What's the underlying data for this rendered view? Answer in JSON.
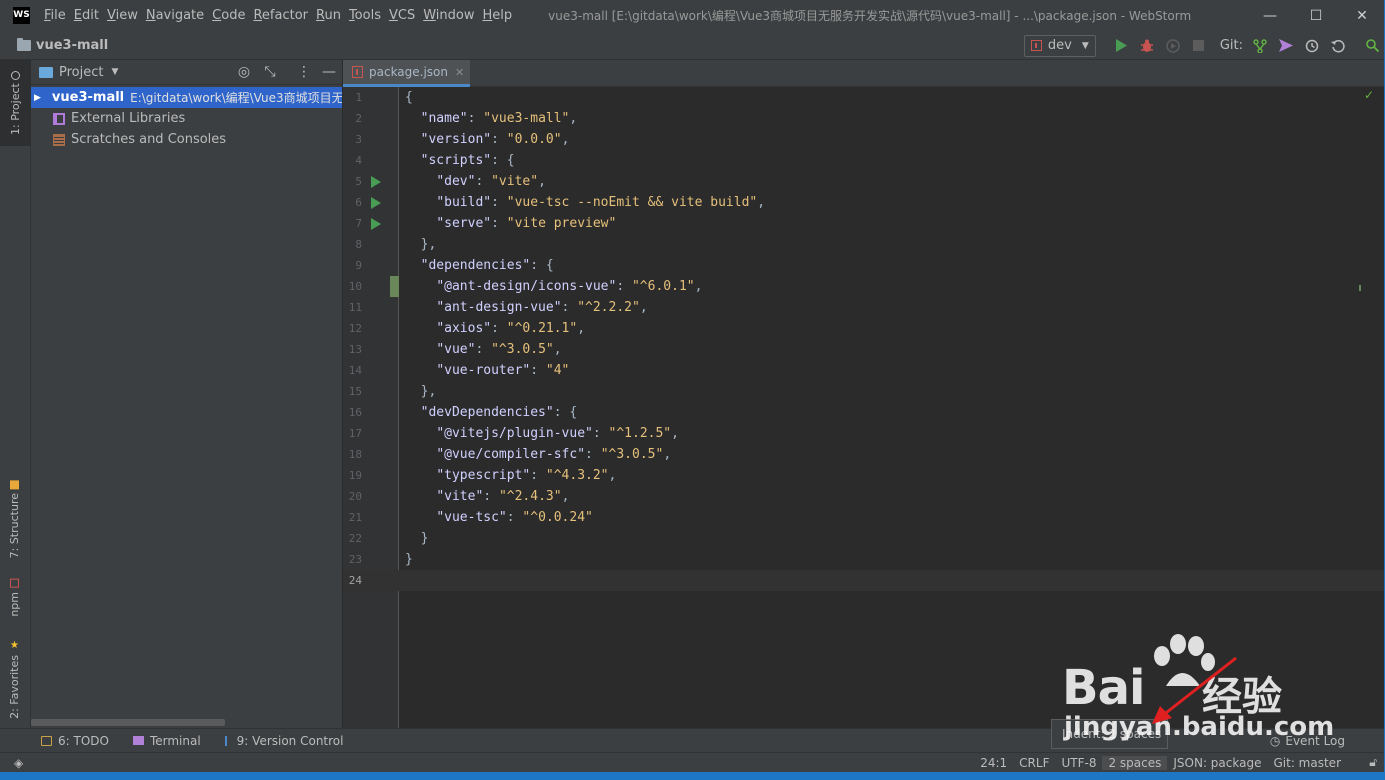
{
  "app": {
    "logo": "WS",
    "window_title": "vue3-mall [E:\\gitdata\\work\\编程\\Vue3商城项目无服务开发实战\\源代码\\vue3-mall] - ...\\package.json - WebStorm"
  },
  "menu": [
    "File",
    "Edit",
    "View",
    "Navigate",
    "Code",
    "Refactor",
    "Run",
    "Tools",
    "VCS",
    "Window",
    "Help"
  ],
  "window_controls": {
    "minimize": "—",
    "maximize": "☐",
    "close": "✕"
  },
  "navbar": {
    "project_name": "vue3-mall",
    "run_config": "dev",
    "git_label": "Git:"
  },
  "left_stripe": {
    "project": "1: Project",
    "structure": "7: Structure",
    "npm": "npm",
    "favorites": "2: Favorites"
  },
  "project_panel": {
    "title": "Project",
    "tree": [
      {
        "name": "vue3-mall",
        "path": "E:\\gitdata\\work\\编程\\Vue3商城项目无"
      },
      {
        "name": "External Libraries"
      },
      {
        "name": "Scratches and Consoles"
      }
    ]
  },
  "editor": {
    "tab": "package.json",
    "current_line": 24,
    "lines": [
      {
        "n": "1",
        "text": "{"
      },
      {
        "n": "2",
        "text": "  \"name\": \"vue3-mall\","
      },
      {
        "n": "3",
        "text": "  \"version\": \"0.0.0\","
      },
      {
        "n": "4",
        "text": "  \"scripts\": {"
      },
      {
        "n": "5",
        "text": "    \"dev\": \"vite\","
      },
      {
        "n": "6",
        "text": "    \"build\": \"vue-tsc --noEmit && vite build\","
      },
      {
        "n": "7",
        "text": "    \"serve\": \"vite preview\""
      },
      {
        "n": "8",
        "text": "  },"
      },
      {
        "n": "9",
        "text": "  \"dependencies\": {"
      },
      {
        "n": "10",
        "text": "    \"@ant-design/icons-vue\": \"^6.0.1\","
      },
      {
        "n": "11",
        "text": "    \"ant-design-vue\": \"^2.2.2\","
      },
      {
        "n": "12",
        "text": "    \"axios\": \"^0.21.1\","
      },
      {
        "n": "13",
        "text": "    \"vue\": \"^3.0.5\","
      },
      {
        "n": "14",
        "text": "    \"vue-router\": \"4\""
      },
      {
        "n": "15",
        "text": "  },"
      },
      {
        "n": "16",
        "text": "  \"devDependencies\": {"
      },
      {
        "n": "17",
        "text": "    \"@vitejs/plugin-vue\": \"^1.2.5\","
      },
      {
        "n": "18",
        "text": "    \"@vue/compiler-sfc\": \"^3.0.5\","
      },
      {
        "n": "19",
        "text": "    \"typescript\": \"^4.3.2\","
      },
      {
        "n": "20",
        "text": "    \"vite\": \"^2.4.3\","
      },
      {
        "n": "21",
        "text": "    \"vue-tsc\": \"^0.0.24\""
      },
      {
        "n": "22",
        "text": "  }"
      },
      {
        "n": "23",
        "text": "}"
      },
      {
        "n": "24",
        "text": ""
      }
    ]
  },
  "tool_windows": {
    "todo": "6: TODO",
    "terminal": "Terminal",
    "version_control": "9: Version Control",
    "event_log": "Event Log"
  },
  "status_bar": {
    "position": "24:1",
    "line_separator": "CRLF",
    "encoding": "UTF-8",
    "indent": "2 spaces",
    "schema": "JSON: package",
    "git_branch": "Git: master"
  },
  "indent_tooltip": "Indent: 2 spaces",
  "watermark": {
    "brand": "Bai",
    "cn": "经验",
    "url": "jingyan.baidu.com"
  },
  "colors": {
    "accent": "#2f65ca",
    "run_green": "#499c54",
    "debug_red": "#c75450",
    "key": "#d0d0ff",
    "string": "#e5c07b"
  }
}
